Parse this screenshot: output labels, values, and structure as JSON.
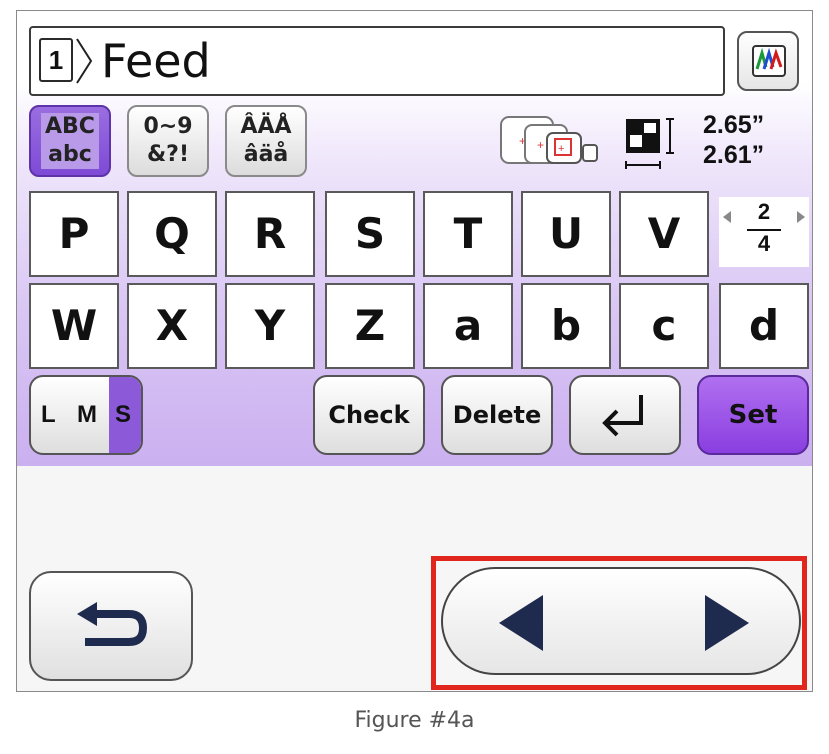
{
  "text_entry": {
    "line_number": "1",
    "text": "Feed"
  },
  "char_sets": [
    {
      "line1": "ABC",
      "line2": "abc"
    },
    {
      "line1": "0~9",
      "line2": "&?!"
    },
    {
      "line1": "ÂÄÅ",
      "line2": "âäå"
    }
  ],
  "selected_char_set": 0,
  "pattern_size": {
    "width": "2.65”",
    "height": "2.61”"
  },
  "keyboard": {
    "row1": [
      "P",
      "Q",
      "R",
      "S",
      "T",
      "U",
      "V"
    ],
    "row2": [
      "W",
      "X",
      "Y",
      "Z",
      "a",
      "b",
      "c",
      "d"
    ]
  },
  "page": {
    "current": "2",
    "total": "4"
  },
  "size_selector": {
    "options": [
      "L",
      "M",
      "S"
    ],
    "selected": "S"
  },
  "buttons": {
    "check": "Check",
    "delete": "Delete",
    "set": "Set"
  },
  "colors": {
    "accent": "#8c5ad8",
    "highlight": "#e0261d",
    "arrow": "#1f2a4f"
  },
  "caption": "Figure #4a"
}
